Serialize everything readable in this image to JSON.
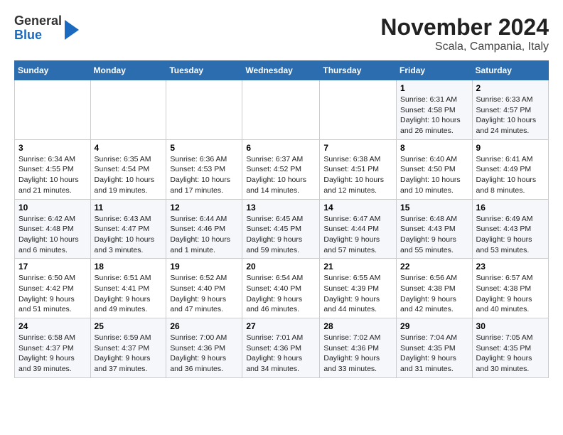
{
  "header": {
    "logo_general": "General",
    "logo_blue": "Blue",
    "title": "November 2024",
    "subtitle": "Scala, Campania, Italy"
  },
  "columns": [
    "Sunday",
    "Monday",
    "Tuesday",
    "Wednesday",
    "Thursday",
    "Friday",
    "Saturday"
  ],
  "weeks": [
    [
      {
        "day": "",
        "sunrise": "",
        "sunset": "",
        "daylight": ""
      },
      {
        "day": "",
        "sunrise": "",
        "sunset": "",
        "daylight": ""
      },
      {
        "day": "",
        "sunrise": "",
        "sunset": "",
        "daylight": ""
      },
      {
        "day": "",
        "sunrise": "",
        "sunset": "",
        "daylight": ""
      },
      {
        "day": "",
        "sunrise": "",
        "sunset": "",
        "daylight": ""
      },
      {
        "day": "1",
        "sunrise": "Sunrise: 6:31 AM",
        "sunset": "Sunset: 4:58 PM",
        "daylight": "Daylight: 10 hours and 26 minutes."
      },
      {
        "day": "2",
        "sunrise": "Sunrise: 6:33 AM",
        "sunset": "Sunset: 4:57 PM",
        "daylight": "Daylight: 10 hours and 24 minutes."
      }
    ],
    [
      {
        "day": "3",
        "sunrise": "Sunrise: 6:34 AM",
        "sunset": "Sunset: 4:55 PM",
        "daylight": "Daylight: 10 hours and 21 minutes."
      },
      {
        "day": "4",
        "sunrise": "Sunrise: 6:35 AM",
        "sunset": "Sunset: 4:54 PM",
        "daylight": "Daylight: 10 hours and 19 minutes."
      },
      {
        "day": "5",
        "sunrise": "Sunrise: 6:36 AM",
        "sunset": "Sunset: 4:53 PM",
        "daylight": "Daylight: 10 hours and 17 minutes."
      },
      {
        "day": "6",
        "sunrise": "Sunrise: 6:37 AM",
        "sunset": "Sunset: 4:52 PM",
        "daylight": "Daylight: 10 hours and 14 minutes."
      },
      {
        "day": "7",
        "sunrise": "Sunrise: 6:38 AM",
        "sunset": "Sunset: 4:51 PM",
        "daylight": "Daylight: 10 hours and 12 minutes."
      },
      {
        "day": "8",
        "sunrise": "Sunrise: 6:40 AM",
        "sunset": "Sunset: 4:50 PM",
        "daylight": "Daylight: 10 hours and 10 minutes."
      },
      {
        "day": "9",
        "sunrise": "Sunrise: 6:41 AM",
        "sunset": "Sunset: 4:49 PM",
        "daylight": "Daylight: 10 hours and 8 minutes."
      }
    ],
    [
      {
        "day": "10",
        "sunrise": "Sunrise: 6:42 AM",
        "sunset": "Sunset: 4:48 PM",
        "daylight": "Daylight: 10 hours and 6 minutes."
      },
      {
        "day": "11",
        "sunrise": "Sunrise: 6:43 AM",
        "sunset": "Sunset: 4:47 PM",
        "daylight": "Daylight: 10 hours and 3 minutes."
      },
      {
        "day": "12",
        "sunrise": "Sunrise: 6:44 AM",
        "sunset": "Sunset: 4:46 PM",
        "daylight": "Daylight: 10 hours and 1 minute."
      },
      {
        "day": "13",
        "sunrise": "Sunrise: 6:45 AM",
        "sunset": "Sunset: 4:45 PM",
        "daylight": "Daylight: 9 hours and 59 minutes."
      },
      {
        "day": "14",
        "sunrise": "Sunrise: 6:47 AM",
        "sunset": "Sunset: 4:44 PM",
        "daylight": "Daylight: 9 hours and 57 minutes."
      },
      {
        "day": "15",
        "sunrise": "Sunrise: 6:48 AM",
        "sunset": "Sunset: 4:43 PM",
        "daylight": "Daylight: 9 hours and 55 minutes."
      },
      {
        "day": "16",
        "sunrise": "Sunrise: 6:49 AM",
        "sunset": "Sunset: 4:43 PM",
        "daylight": "Daylight: 9 hours and 53 minutes."
      }
    ],
    [
      {
        "day": "17",
        "sunrise": "Sunrise: 6:50 AM",
        "sunset": "Sunset: 4:42 PM",
        "daylight": "Daylight: 9 hours and 51 minutes."
      },
      {
        "day": "18",
        "sunrise": "Sunrise: 6:51 AM",
        "sunset": "Sunset: 4:41 PM",
        "daylight": "Daylight: 9 hours and 49 minutes."
      },
      {
        "day": "19",
        "sunrise": "Sunrise: 6:52 AM",
        "sunset": "Sunset: 4:40 PM",
        "daylight": "Daylight: 9 hours and 47 minutes."
      },
      {
        "day": "20",
        "sunrise": "Sunrise: 6:54 AM",
        "sunset": "Sunset: 4:40 PM",
        "daylight": "Daylight: 9 hours and 46 minutes."
      },
      {
        "day": "21",
        "sunrise": "Sunrise: 6:55 AM",
        "sunset": "Sunset: 4:39 PM",
        "daylight": "Daylight: 9 hours and 44 minutes."
      },
      {
        "day": "22",
        "sunrise": "Sunrise: 6:56 AM",
        "sunset": "Sunset: 4:38 PM",
        "daylight": "Daylight: 9 hours and 42 minutes."
      },
      {
        "day": "23",
        "sunrise": "Sunrise: 6:57 AM",
        "sunset": "Sunset: 4:38 PM",
        "daylight": "Daylight: 9 hours and 40 minutes."
      }
    ],
    [
      {
        "day": "24",
        "sunrise": "Sunrise: 6:58 AM",
        "sunset": "Sunset: 4:37 PM",
        "daylight": "Daylight: 9 hours and 39 minutes."
      },
      {
        "day": "25",
        "sunrise": "Sunrise: 6:59 AM",
        "sunset": "Sunset: 4:37 PM",
        "daylight": "Daylight: 9 hours and 37 minutes."
      },
      {
        "day": "26",
        "sunrise": "Sunrise: 7:00 AM",
        "sunset": "Sunset: 4:36 PM",
        "daylight": "Daylight: 9 hours and 36 minutes."
      },
      {
        "day": "27",
        "sunrise": "Sunrise: 7:01 AM",
        "sunset": "Sunset: 4:36 PM",
        "daylight": "Daylight: 9 hours and 34 minutes."
      },
      {
        "day": "28",
        "sunrise": "Sunrise: 7:02 AM",
        "sunset": "Sunset: 4:36 PM",
        "daylight": "Daylight: 9 hours and 33 minutes."
      },
      {
        "day": "29",
        "sunrise": "Sunrise: 7:04 AM",
        "sunset": "Sunset: 4:35 PM",
        "daylight": "Daylight: 9 hours and 31 minutes."
      },
      {
        "day": "30",
        "sunrise": "Sunrise: 7:05 AM",
        "sunset": "Sunset: 4:35 PM",
        "daylight": "Daylight: 9 hours and 30 minutes."
      }
    ]
  ]
}
